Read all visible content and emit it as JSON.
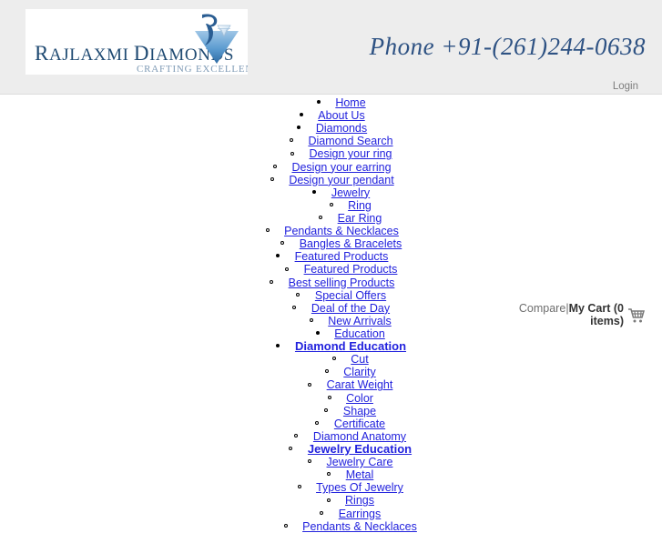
{
  "header": {
    "logo": {
      "wordmark_first": "R",
      "wordmark_rest": "AJLAXMI ",
      "wordmark_second": "D",
      "wordmark_rest2": "IAMONDS",
      "full_wordmark": "RAJLAXMI DIAMONDS",
      "tagline": "CRAFTING EXCELLENCE",
      "mark_name": "rajlaxmi-diamond-monogram"
    },
    "phone": "Phone +91-(261)244-0638",
    "login_label": "Login",
    "background_color": "#ededed",
    "brand_color": "#1f4a72"
  },
  "nav": {
    "items": [
      {
        "label": "Home",
        "level": 1,
        "indent": 1,
        "bold": false
      },
      {
        "label": "About Us",
        "level": 1,
        "indent": 0,
        "bold": false
      },
      {
        "label": "Diamonds",
        "level": 1,
        "indent": 0,
        "bold": false
      },
      {
        "label": "Diamond Search",
        "level": 2,
        "indent": 1,
        "bold": false
      },
      {
        "label": "Design your ring",
        "level": 2,
        "indent": 1,
        "bold": false
      },
      {
        "label": "Design your earring",
        "level": 2,
        "indent": 0,
        "bold": false
      },
      {
        "label": "Design your pendant",
        "level": 2,
        "indent": 0,
        "bold": false
      },
      {
        "label": "Jewelry",
        "level": 1,
        "indent": 1,
        "bold": false
      },
      {
        "label": "Ring",
        "level": 2,
        "indent": 2,
        "bold": false
      },
      {
        "label": "Ear Ring",
        "level": 2,
        "indent": 2,
        "bold": false
      },
      {
        "label": "Pendants & Necklaces",
        "level": 2,
        "indent": 0,
        "bold": false
      },
      {
        "label": "Bangles & Bracelets",
        "level": 2,
        "indent": 1,
        "bold": false
      },
      {
        "label": "Featured Products",
        "level": 1,
        "indent": 0,
        "bold": false
      },
      {
        "label": "Featured Products",
        "level": 2,
        "indent": 1,
        "bold": false
      },
      {
        "label": "Best selling Products",
        "level": 2,
        "indent": 0,
        "bold": false
      },
      {
        "label": "Special Offers",
        "level": 2,
        "indent": 1,
        "bold": false
      },
      {
        "label": "Deal of the Day",
        "level": 2,
        "indent": 1,
        "bold": false
      },
      {
        "label": "New Arrivals",
        "level": 2,
        "indent": 2,
        "bold": false
      },
      {
        "label": "Education",
        "level": 1,
        "indent": 2,
        "bold": false
      },
      {
        "label": "Diamond Education",
        "level": 1,
        "indent": 1,
        "bold": true
      },
      {
        "label": "Cut",
        "level": 2,
        "indent": 2,
        "bold": false
      },
      {
        "label": "Clarity",
        "level": 2,
        "indent": 2,
        "bold": false
      },
      {
        "label": "Carat Weight",
        "level": 2,
        "indent": 2,
        "bold": false
      },
      {
        "label": "Color",
        "level": 2,
        "indent": 2,
        "bold": false
      },
      {
        "label": "Shape",
        "level": 2,
        "indent": 2,
        "bold": false
      },
      {
        "label": "Certificate",
        "level": 2,
        "indent": 2,
        "bold": false
      },
      {
        "label": "Diamond Anatomy",
        "level": 2,
        "indent": 2,
        "bold": false
      },
      {
        "label": "Jewelry Education",
        "level": 2,
        "indent": 2,
        "bold": true
      },
      {
        "label": "Jewelry Care",
        "level": 2,
        "indent": 2,
        "bold": false
      },
      {
        "label": "Metal",
        "level": 2,
        "indent": 2,
        "bold": false
      },
      {
        "label": "Types Of Jewelry",
        "level": 2,
        "indent": 2,
        "bold": false
      },
      {
        "label": "Rings",
        "level": 2,
        "indent": 2,
        "bold": false
      },
      {
        "label": "Earrings",
        "level": 2,
        "indent": 2,
        "bold": false
      },
      {
        "label": "Pendants & Necklaces",
        "level": 2,
        "indent": 2,
        "bold": false
      }
    ]
  },
  "cart_bar": {
    "compare_label": "Compare",
    "separator": "|",
    "my_cart_label": "My Cart (0 items)",
    "cart_icon_name": "shopping-cart-icon"
  },
  "colors": {
    "link": "#2222dd",
    "header_bg": "#ededed",
    "page_bg": "#ffffff",
    "muted_text": "#6e6e6e"
  }
}
